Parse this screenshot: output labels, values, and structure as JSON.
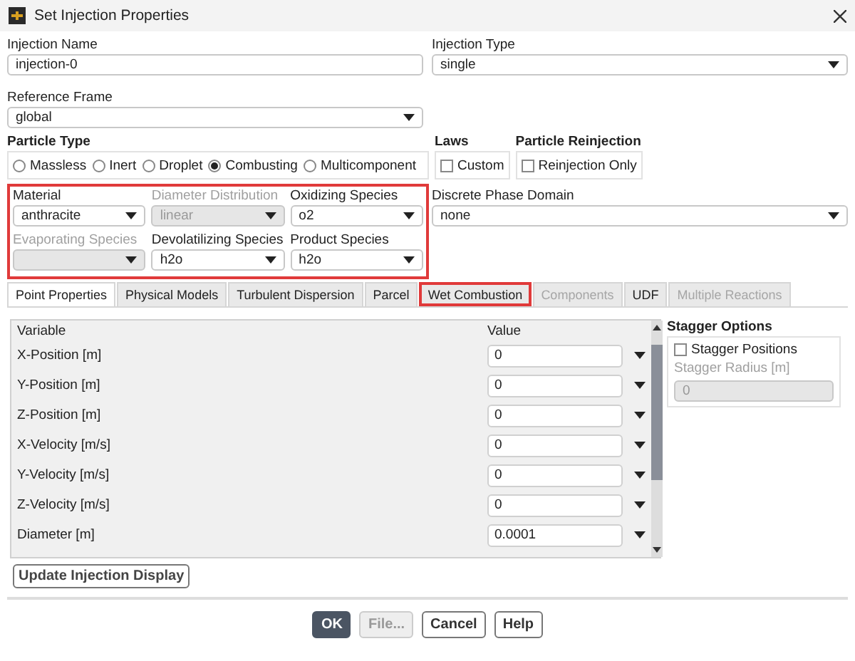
{
  "window": {
    "title": "Set Injection Properties"
  },
  "injection_name": {
    "label": "Injection Name",
    "value": "injection-0"
  },
  "injection_type": {
    "label": "Injection Type",
    "value": "single"
  },
  "reference_frame": {
    "label": "Reference Frame",
    "value": "global"
  },
  "particle_type": {
    "label": "Particle Type",
    "options": [
      {
        "label": "Massless",
        "selected": false
      },
      {
        "label": "Inert",
        "selected": false
      },
      {
        "label": "Droplet",
        "selected": false
      },
      {
        "label": "Combusting",
        "selected": true
      },
      {
        "label": "Multicomponent",
        "selected": false
      }
    ]
  },
  "laws": {
    "label": "Laws",
    "options": [
      {
        "label": "Custom",
        "checked": false
      }
    ]
  },
  "particle_reinjection": {
    "label": "Particle Reinjection",
    "options": [
      {
        "label": "Reinjection Only",
        "checked": false
      }
    ]
  },
  "species": {
    "highlighted": true,
    "fields": [
      {
        "label": "Material",
        "value": "anthracite",
        "disabled": false
      },
      {
        "label": "Diameter Distribution",
        "value": "linear",
        "disabled": true
      },
      {
        "label": "Oxidizing Species",
        "value": "o2",
        "disabled": false
      },
      {
        "label": "Evaporating Species",
        "disabled": true
      },
      {
        "label": "Devolatilizing Species",
        "value": "h2o",
        "disabled": false
      },
      {
        "label": "Product Species",
        "value": "h2o",
        "disabled": false
      }
    ]
  },
  "discrete_phase_domain": {
    "label": "Discrete Phase Domain",
    "value": "none"
  },
  "tabs": [
    {
      "label": "Point Properties",
      "selected": true,
      "disabled": false,
      "highlighted": false
    },
    {
      "label": "Physical Models",
      "selected": false,
      "disabled": false,
      "highlighted": false
    },
    {
      "label": "Turbulent Dispersion",
      "selected": false,
      "disabled": false,
      "highlighted": false
    },
    {
      "label": "Parcel",
      "selected": false,
      "disabled": false,
      "highlighted": false
    },
    {
      "label": "Wet Combustion",
      "selected": false,
      "disabled": false,
      "highlighted": true
    },
    {
      "label": "Components",
      "selected": false,
      "disabled": true,
      "highlighted": false
    },
    {
      "label": "UDF",
      "selected": false,
      "disabled": false,
      "highlighted": false
    },
    {
      "label": "Multiple Reactions",
      "selected": false,
      "disabled": true,
      "highlighted": false
    }
  ],
  "table": {
    "columns": [
      "Variable",
      "Value"
    ],
    "rows": [
      {
        "variable": "X-Position [m]",
        "value": "0"
      },
      {
        "variable": "Y-Position [m]",
        "value": "0"
      },
      {
        "variable": "Z-Position [m]",
        "value": "0"
      },
      {
        "variable": "X-Velocity [m/s]",
        "value": "0"
      },
      {
        "variable": "Y-Velocity [m/s]",
        "value": "0"
      },
      {
        "variable": "Z-Velocity [m/s]",
        "value": "0"
      },
      {
        "variable": "Diameter [m]",
        "value": "0.0001"
      }
    ]
  },
  "stagger_options": {
    "title": "Stagger Options",
    "stagger_positions": {
      "label": "Stagger Positions",
      "checked": false
    },
    "stagger_radius": {
      "label": "Stagger Radius [m]",
      "value": "0",
      "disabled": true
    }
  },
  "update_button": "Update Injection Display",
  "buttons": [
    {
      "label": "OK",
      "kind": "primary"
    },
    {
      "label": "File...",
      "kind": "disabled"
    },
    {
      "label": "Cancel",
      "kind": "normal"
    },
    {
      "label": "Help",
      "kind": "normal"
    }
  ]
}
